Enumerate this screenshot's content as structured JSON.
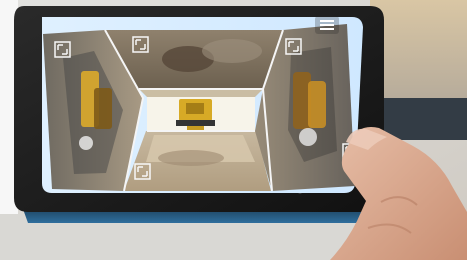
{
  "tablet_ui": {
    "menu_icon": "hamburger-menu-icon",
    "view_icons": [
      "expand-icon",
      "expand-icon",
      "expand-icon",
      "expand-icon",
      "expand-icon"
    ]
  }
}
